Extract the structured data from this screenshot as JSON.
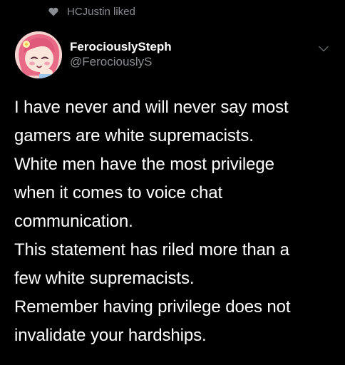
{
  "social_context": {
    "icon": "heart-icon",
    "text": "HCJustin liked"
  },
  "author": {
    "display_name": "FerociouslySteph",
    "handle": "@FerociouslyS",
    "avatar": "avatar-illustration"
  },
  "menu": {
    "icon": "chevron-down-icon"
  },
  "tweet": {
    "lines": [
      "I have never and will never say most",
      "gamers are white supremacists.",
      "White men have the most privilege",
      "when it comes to voice chat",
      "communication.",
      "This statement has riled more than a",
      "few white supremacists.",
      "Remember having privilege does not",
      "invalidate your hardships."
    ]
  },
  "colors": {
    "background": "#000000",
    "primary_text": "#ffffff",
    "secondary_text": "#8a8d91",
    "avatar_bg": "#f3d2cf",
    "avatar_hair": "#e86a86"
  }
}
